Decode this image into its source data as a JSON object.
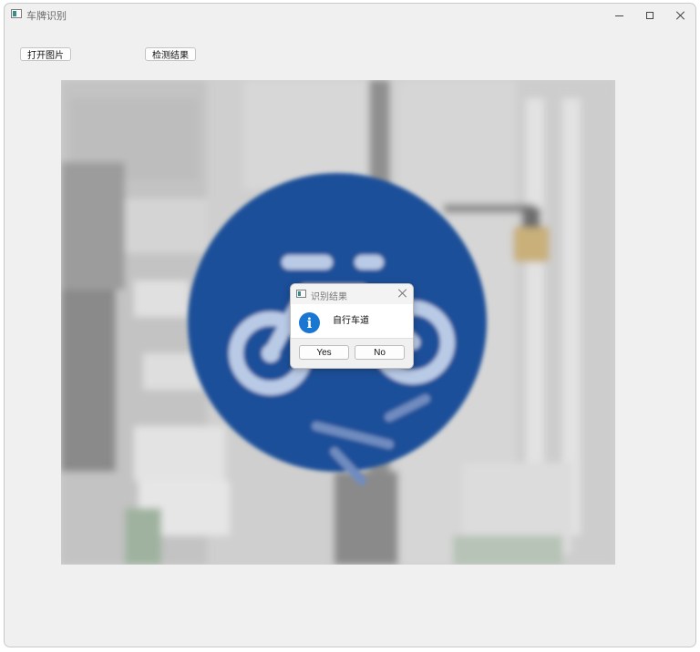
{
  "window": {
    "title": "车牌识别",
    "controls": {
      "minimize": "minimize-icon",
      "maximize": "maximize-icon",
      "close": "close-icon"
    }
  },
  "toolbar": {
    "open_image_label": "打开图片",
    "detect_result_label": "检测结果"
  },
  "image": {
    "description_icon": "bicycle-lane-sign-image"
  },
  "dialog": {
    "title": "识别结果",
    "message": "自行车道",
    "icon": "info-icon",
    "icon_glyph": "i",
    "yes_label": "Yes",
    "no_label": "No"
  },
  "colors": {
    "sign_blue": "#1f4f99",
    "info_blue": "#1976d2",
    "window_bg": "#f0f0f0"
  }
}
